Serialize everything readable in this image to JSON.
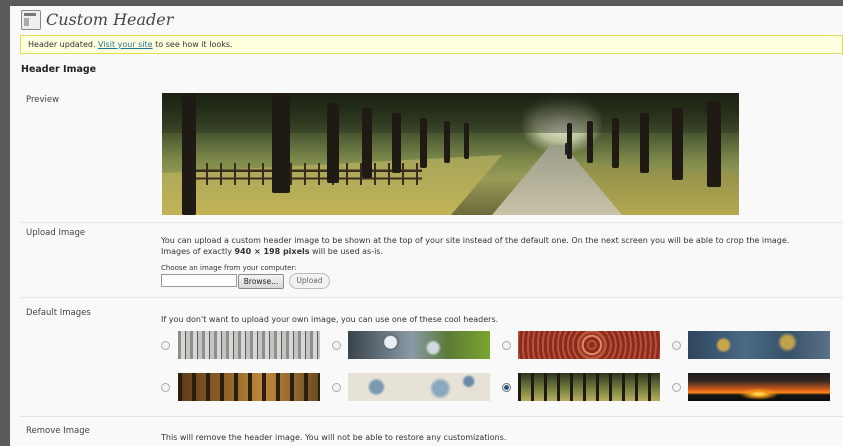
{
  "page": {
    "title": "Custom Header",
    "title_icon": "appearance-icon"
  },
  "notice": {
    "prefix": "Header updated. ",
    "link": "Visit your site",
    "suffix": " to see how it looks."
  },
  "section": {
    "title": "Header Image"
  },
  "preview": {
    "label": "Preview"
  },
  "upload": {
    "label": "Upload Image",
    "desc_line1": "You can upload a custom header image to be shown at the top of your site instead of the default one. On the next screen you will be able to crop the image.",
    "desc_line2_prefix": "Images of exactly ",
    "desc_line2_bold": "940 × 198 pixels",
    "desc_line2_suffix": " will be used as-is.",
    "choose_label": "Choose an image from your computer:",
    "browse_label": "Browse...",
    "upload_button": "Upload"
  },
  "defaults": {
    "label": "Default Images",
    "desc": "If you don't want to upload your own image, you can use one of these cool headers.",
    "selected_index": 6
  },
  "remove": {
    "label": "Remove Image",
    "desc": "This will remove the header image. You will not be able to restore any customizations."
  }
}
